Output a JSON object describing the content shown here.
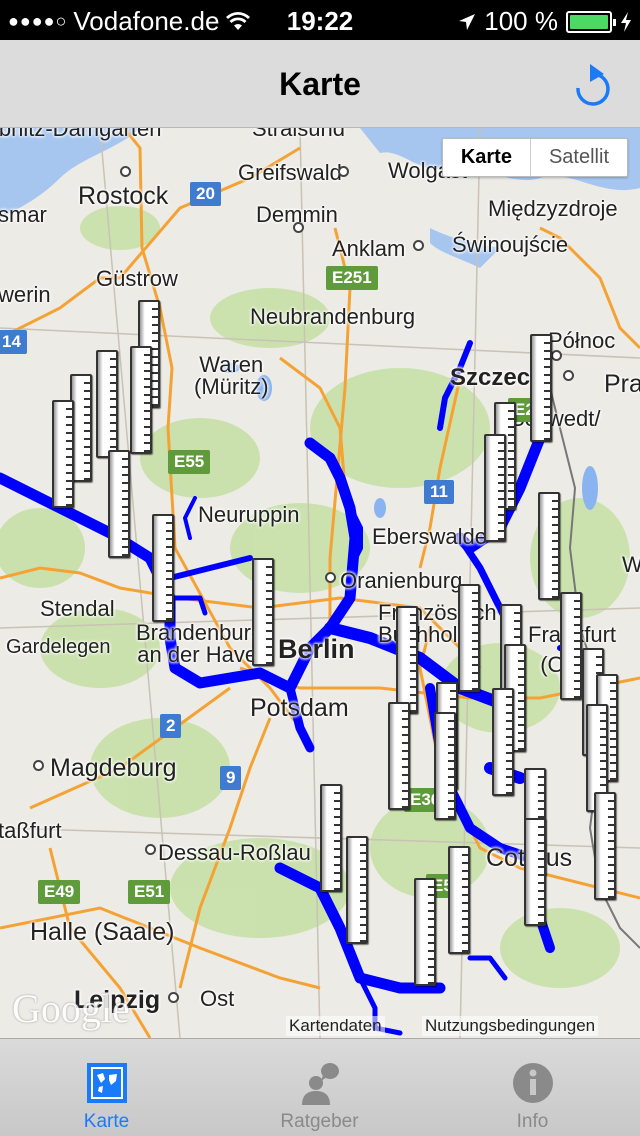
{
  "status_bar": {
    "signal": "●●●●○",
    "carrier": "Vodafone.de",
    "wifi_icon": "wifi-icon",
    "time": "19:22",
    "location_icon": "location-arrow-icon",
    "battery_percent": "100 %",
    "battery_level": 1.0,
    "charging_icon": "bolt-icon"
  },
  "nav": {
    "title": "Karte",
    "refresh_icon": "refresh-icon",
    "accent_color": "#1a7af8"
  },
  "map": {
    "type_control": {
      "options": [
        "Karte",
        "Satellit"
      ],
      "selected": "Karte"
    },
    "labels": {
      "ribnitz": "ibnitz-Damgarten",
      "stralsund": "Stralsund",
      "rostock": "Rostock",
      "greifswald": "Greifswald",
      "wolgast": "Wolgast",
      "wismar": "smar",
      "demmin": "Demmin",
      "miedzyzdroje": "Międzyzdroje",
      "anklam": "Anklam",
      "swinoujscie": "Świnoujście",
      "gustrow": "Güstrow",
      "schwerin": "werin",
      "neubrandenburg": "Neubrandenburg",
      "polnoc": "Północ",
      "waren": "Waren\n(Müritz)",
      "szczecin": "Szczecin",
      "pra": "Pra",
      "schwedt": "Schwedt/",
      "neuruppin": "Neuruppin",
      "eberswalde": "Eberswalde",
      "oranienburg": "Oranienburg",
      "stendal": "Stendal",
      "gardelegen": "Gardelegen",
      "brandenburg": "Brandenburg\nan der Havel",
      "berlin": "Berlin",
      "furstenwalde": "Französisch\nBuchholz",
      "frankfurt": "Frankfurt\n(Oder)",
      "potsdam": "Potsdam",
      "magdeburg": "Magdeburg",
      "stassfurt": "taßfurt",
      "dessau": "Dessau-Roßlau",
      "cottbus": "Cottbus",
      "halle": "Halle (Saale)",
      "leipzig": "Leipzig",
      "ost": "Ost",
      "w": "W"
    },
    "shields": {
      "a20": "20",
      "a14": "14",
      "e251": "E251",
      "e55": "E55",
      "a11": "11",
      "a2": "2",
      "a9": "9",
      "e49": "E49",
      "e51": "E51",
      "e36": "E36",
      "e55b": "E55",
      "e28": "E28"
    },
    "google_logo": "Google",
    "attribution": {
      "data": "Kartendaten",
      "terms": "Nutzungsbedingungen"
    },
    "gauge_marker_count": 30
  },
  "tabs": [
    {
      "label": "Karte",
      "icon": "map-icon",
      "active": true
    },
    {
      "label": "Ratgeber",
      "icon": "advisor-chat-icon",
      "active": false
    },
    {
      "label": "Info",
      "icon": "info-icon",
      "active": false
    }
  ]
}
